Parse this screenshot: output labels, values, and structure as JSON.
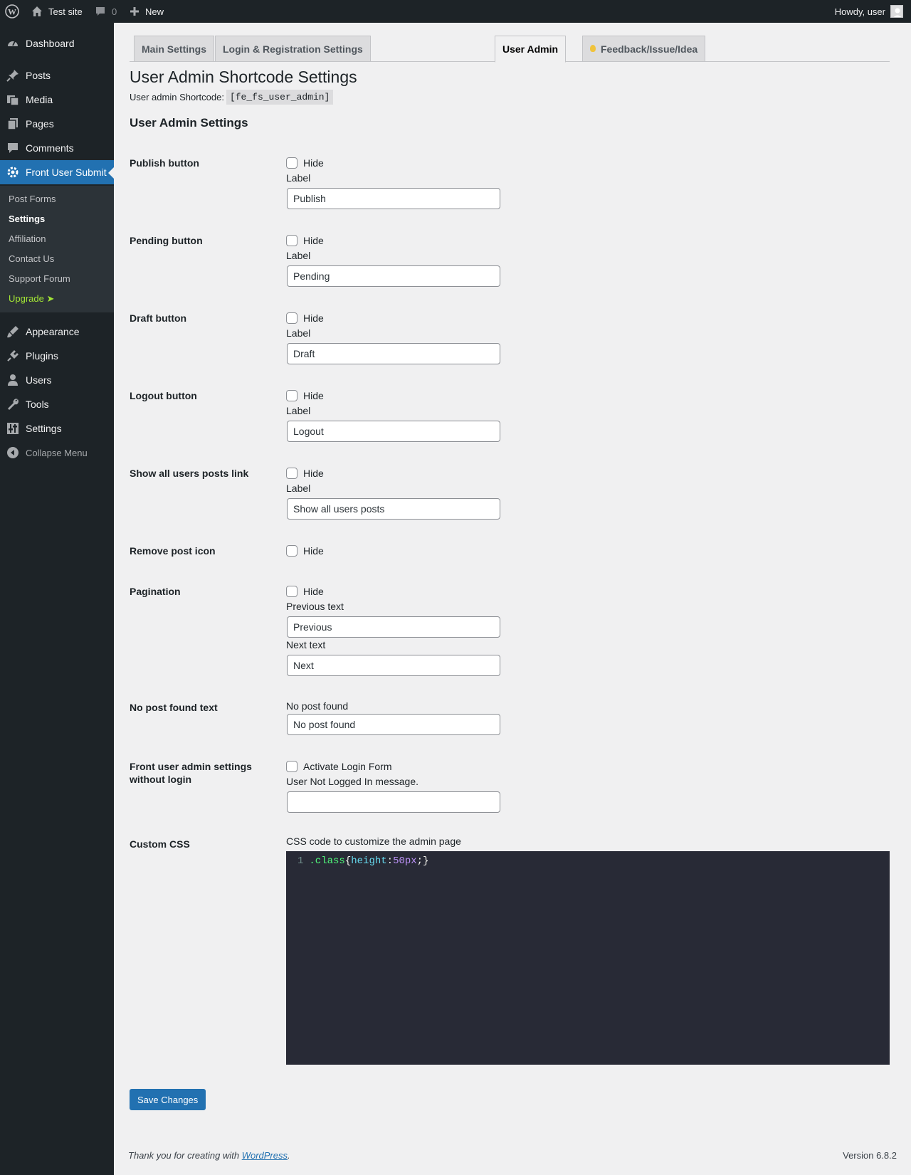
{
  "admin_bar": {
    "site_name": "Test site",
    "comments_count": "0",
    "new_label": "New",
    "greeting": "Howdy, user"
  },
  "sidebar": {
    "items": [
      {
        "label": "Dashboard",
        "icon": "dashboard-icon"
      },
      {
        "label": "Posts",
        "icon": "pin-icon"
      },
      {
        "label": "Media",
        "icon": "media-icon"
      },
      {
        "label": "Pages",
        "icon": "pages-icon"
      },
      {
        "label": "Comments",
        "icon": "comment-icon"
      },
      {
        "label": "Front User Submit",
        "icon": "gear-icon"
      },
      {
        "label": "Appearance",
        "icon": "brush-icon"
      },
      {
        "label": "Plugins",
        "icon": "plug-icon"
      },
      {
        "label": "Users",
        "icon": "user-icon"
      },
      {
        "label": "Tools",
        "icon": "wrench-icon"
      },
      {
        "label": "Settings",
        "icon": "sliders-icon"
      }
    ],
    "submenu": [
      "Post Forms",
      "Settings",
      "Affiliation",
      "Contact Us",
      "Support Forum",
      "Upgrade ➤"
    ],
    "collapse_label": "Collapse Menu"
  },
  "tabs": [
    "Main Settings",
    "Login & Registration Settings",
    "User Admin",
    "Feedback/Issue/Idea"
  ],
  "page": {
    "title": "User Admin Shortcode Settings",
    "shortcode_label": "User admin Shortcode:",
    "shortcode": "[fe_fs_user_admin]",
    "section_title": "User Admin Settings"
  },
  "settings": {
    "publish": {
      "label": "Publish button",
      "hide": "Hide",
      "field_label": "Label",
      "value": "Publish"
    },
    "pending": {
      "label": "Pending button",
      "hide": "Hide",
      "field_label": "Label",
      "value": "Pending"
    },
    "draft": {
      "label": "Draft button",
      "hide": "Hide",
      "field_label": "Label",
      "value": "Draft"
    },
    "logout": {
      "label": "Logout button",
      "hide": "Hide",
      "field_label": "Label",
      "value": "Logout"
    },
    "show_all": {
      "label": "Show all users posts link",
      "hide": "Hide",
      "field_label": "Label",
      "value": "Show all users posts"
    },
    "remove_icon": {
      "label": "Remove post icon",
      "hide": "Hide"
    },
    "pagination": {
      "label": "Pagination",
      "hide": "Hide",
      "prev_label": "Previous text",
      "prev_value": "Previous",
      "next_label": "Next text",
      "next_value": "Next"
    },
    "no_post": {
      "label": "No post found text",
      "field_label": "No post found",
      "value": "No post found"
    },
    "without_login": {
      "label": "Front user admin settings without login",
      "checkbox_label": "Activate Login Form",
      "field_label": "User Not Logged In message.",
      "value": ""
    },
    "custom_css": {
      "label": "Custom CSS",
      "field_label": "CSS code to customize the admin page",
      "line_number": "1",
      "selector": ".class",
      "open_brace": "{",
      "property": "height",
      "colon": ":",
      "value": "50px",
      "close": ";}"
    }
  },
  "buttons": {
    "save": "Save Changes"
  },
  "footer": {
    "thanks_prefix": "Thank you for creating with ",
    "link": "WordPress",
    "thanks_suffix": ".",
    "version": "Version 6.8.2"
  },
  "colors": {
    "accent": "#2271b1",
    "sidebar_bg": "#1d2327",
    "upgrade": "#a3e635"
  }
}
